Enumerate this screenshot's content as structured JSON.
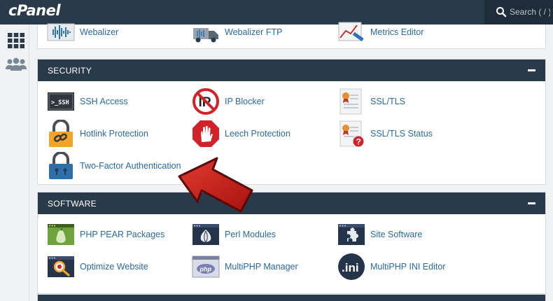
{
  "header": {
    "logo": "cPanel",
    "search_placeholder": "Search ( / )"
  },
  "rail": {
    "icons": [
      "grid-icon",
      "users-icon"
    ]
  },
  "top_section": {
    "items": [
      {
        "label": "Webalizer",
        "icon": "webalizer-icon"
      },
      {
        "label": "Webalizer FTP",
        "icon": "webalizer-ftp-icon"
      },
      {
        "label": "Metrics Editor",
        "icon": "metrics-editor-icon"
      }
    ]
  },
  "security": {
    "title": "SECURITY",
    "items": [
      {
        "label": "SSH Access",
        "icon": "ssh-icon"
      },
      {
        "label": "IP Blocker",
        "icon": "ip-blocker-icon"
      },
      {
        "label": "SSL/TLS",
        "icon": "certificate-icon"
      },
      {
        "label": "Hotlink Protection",
        "icon": "hotlink-lock-icon"
      },
      {
        "label": "Leech Protection",
        "icon": "stop-hand-icon"
      },
      {
        "label": "SSL/TLS Status",
        "icon": "certificate-status-icon"
      },
      {
        "label": "Two-Factor Authentication",
        "icon": "padlock-icon"
      }
    ]
  },
  "software": {
    "title": "SOFTWARE",
    "items": [
      {
        "label": "PHP PEAR Packages",
        "icon": "pear-icon"
      },
      {
        "label": "Perl Modules",
        "icon": "perl-onion-icon"
      },
      {
        "label": "Site Software",
        "icon": "puzzle-icon"
      },
      {
        "label": "Optimize Website",
        "icon": "optimize-magnifier-icon"
      },
      {
        "label": "MultiPHP Manager",
        "icon": "php-icon"
      },
      {
        "label": "MultiPHP INI Editor",
        "icon": "ini-icon"
      }
    ]
  },
  "colors": {
    "header": "#293a4a",
    "link": "#2b6aa1",
    "accent": "#cc1f1f"
  }
}
